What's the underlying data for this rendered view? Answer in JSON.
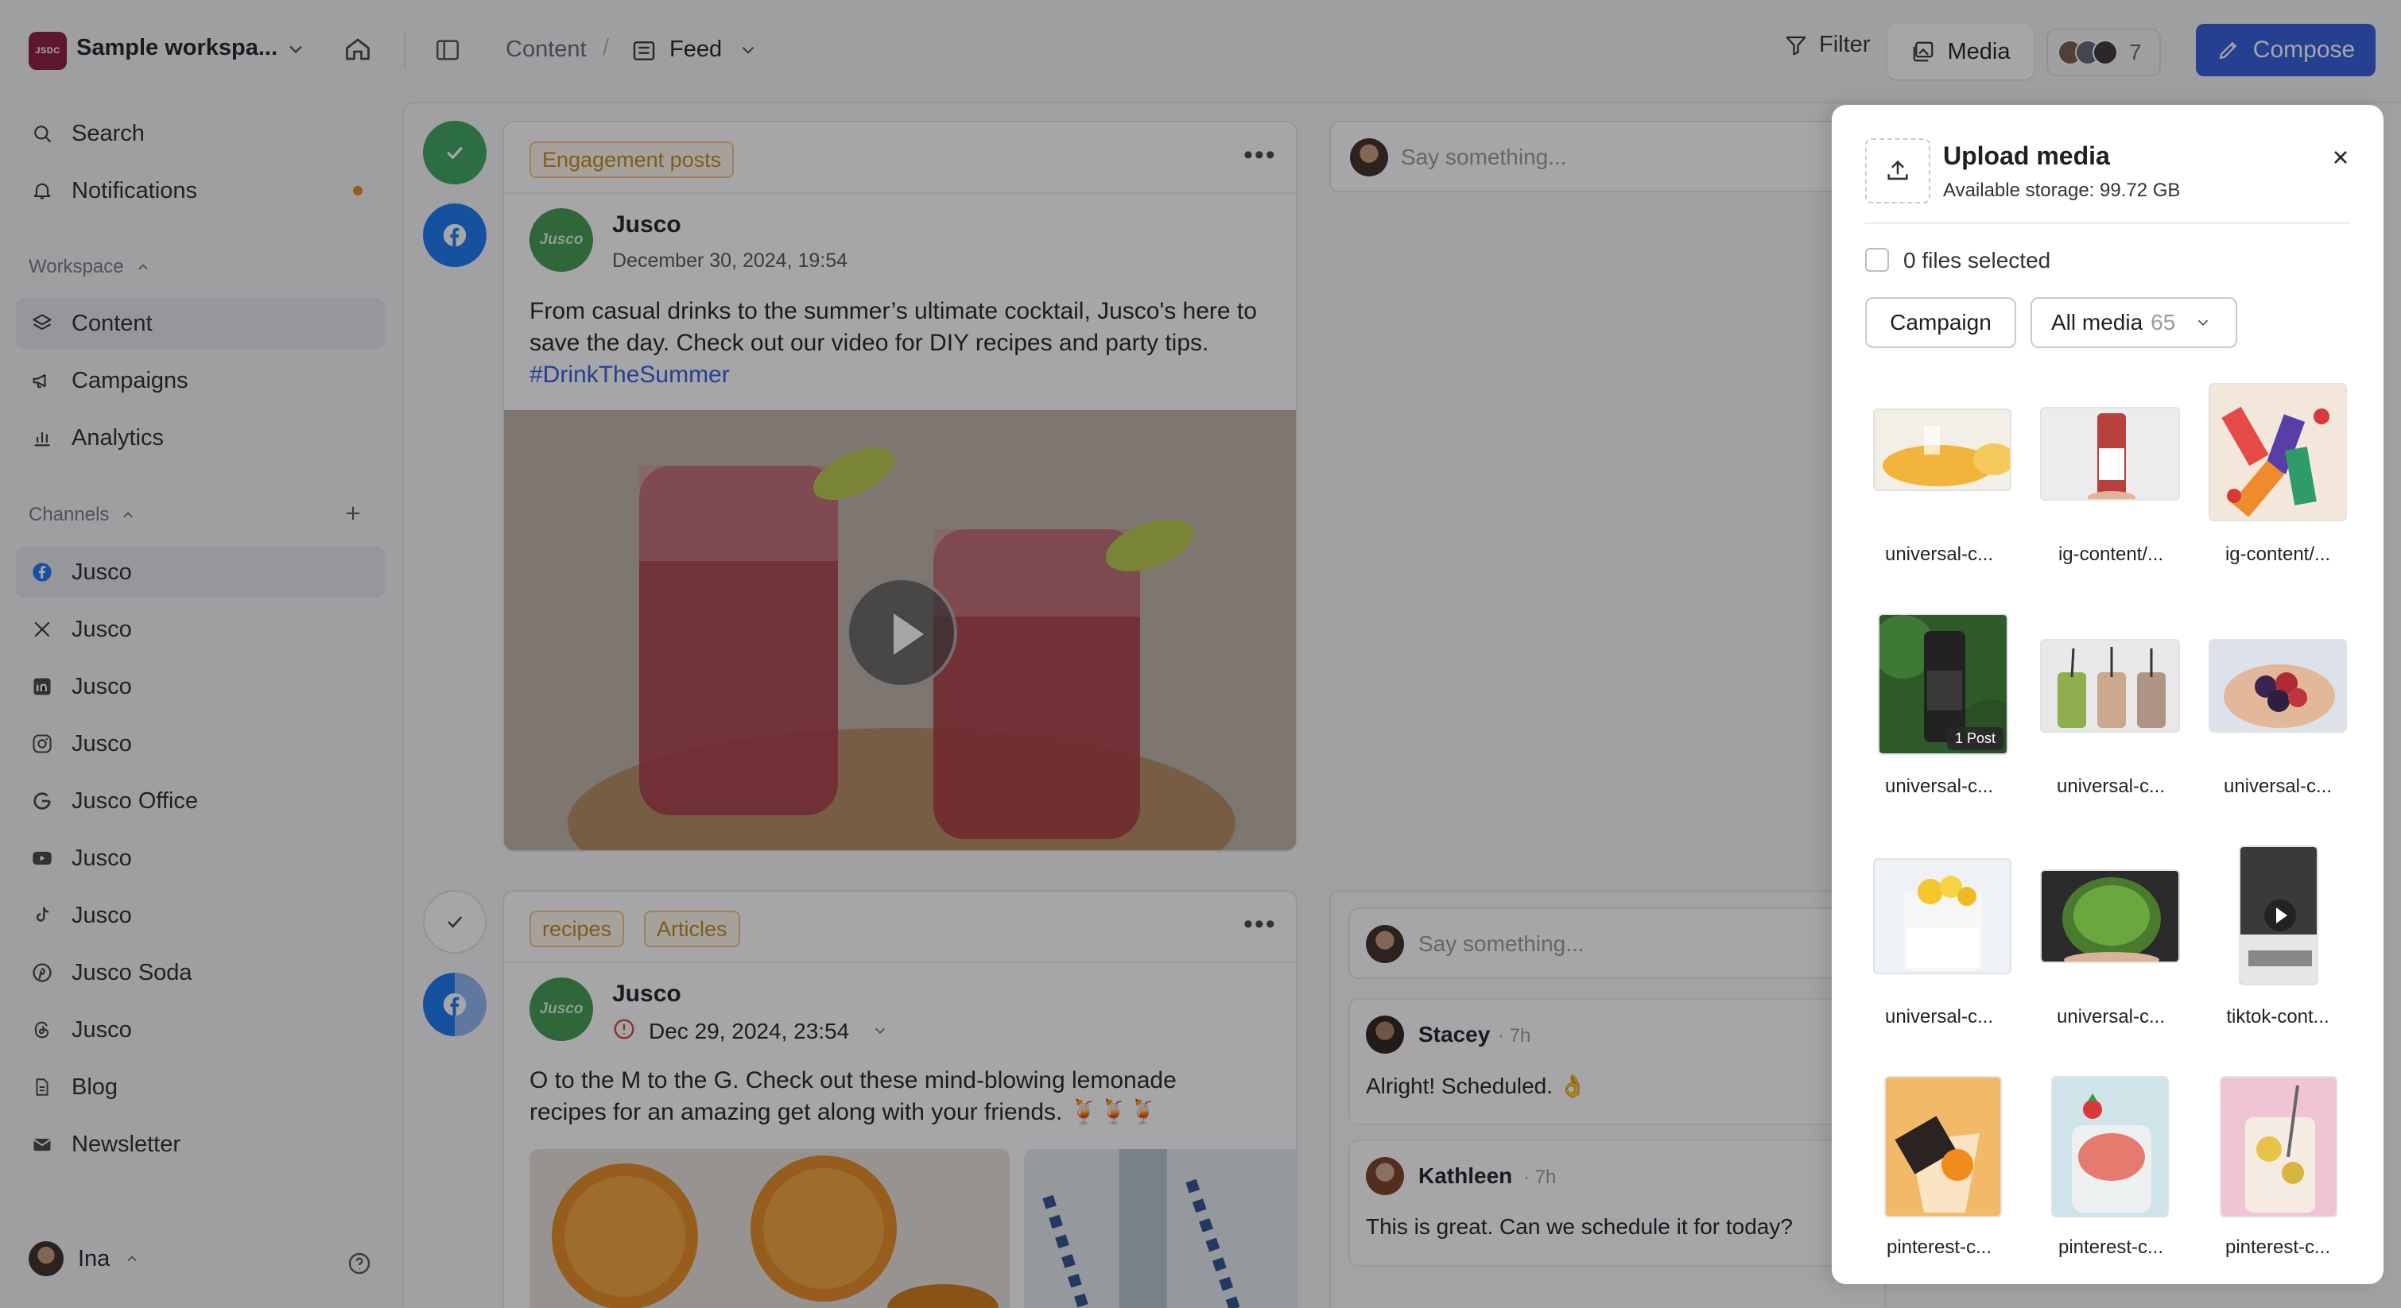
{
  "workspace": {
    "logo_text": "JSDC",
    "name": "Sample workspa..."
  },
  "breadcrumb": {
    "content": "Content",
    "separator": "/",
    "feed": "Feed"
  },
  "toolbar": {
    "filter_label": "Filter",
    "media_label": "Media",
    "collaborator_count": "7",
    "compose_label": "Compose"
  },
  "sidebar": {
    "search": "Search",
    "notifications": "Notifications",
    "workspace_label": "Workspace",
    "workspace_items": [
      "Content",
      "Campaigns",
      "Analytics"
    ],
    "channels_label": "Channels",
    "channels": [
      {
        "label": "Jusco",
        "icon": "facebook-icon"
      },
      {
        "label": "Jusco",
        "icon": "x-icon"
      },
      {
        "label": "Jusco",
        "icon": "linkedin-icon"
      },
      {
        "label": "Jusco",
        "icon": "instagram-icon"
      },
      {
        "label": "Jusco Office",
        "icon": "google-icon"
      },
      {
        "label": "Jusco",
        "icon": "youtube-icon"
      },
      {
        "label": "Jusco",
        "icon": "tiktok-icon"
      },
      {
        "label": "Jusco Soda",
        "icon": "pinterest-icon"
      },
      {
        "label": "Jusco",
        "icon": "threads-icon"
      },
      {
        "label": "Blog",
        "icon": "document-icon"
      },
      {
        "label": "Newsletter",
        "icon": "mail-icon"
      }
    ],
    "user": "Ina"
  },
  "posts": [
    {
      "tags": [
        "Engagement posts"
      ],
      "avatar_text": "Jusco",
      "author": "Jusco",
      "date": "December 30, 2024, 19:54",
      "text": "From casual drinks to the summer’s ultimate cocktail, Jusco's here to save the day. Check out our video for DIY recipes and party tips.",
      "hashtag": "#DrinkTheSummer",
      "comment_placeholder": "Say something..."
    },
    {
      "tags": [
        "recipes",
        "Articles"
      ],
      "avatar_text": "Jusco",
      "author": "Jusco",
      "date": "Dec 29, 2024, 23:54",
      "text": "O to the M to the G. Check out these mind-blowing lemonade recipes for an amazing get along with your friends. 🍹🍹🍹",
      "comment_placeholder": "Say something...",
      "comments": [
        {
          "author": "Stacey",
          "time": "· 7h",
          "text": "Alright! Scheduled. 👌"
        },
        {
          "author": "Kathleen",
          "time": "· 7h",
          "text": "This is great. Can we schedule it for today?"
        }
      ]
    }
  ],
  "media_panel": {
    "title": "Upload media",
    "storage": "Available storage: 99.72 GB",
    "selected": "0 files selected",
    "campaign_button": "Campaign",
    "filter_label": "All media",
    "filter_count": "65",
    "items": [
      {
        "label": "universal-c..."
      },
      {
        "label": "ig-content/..."
      },
      {
        "label": "ig-content/..."
      },
      {
        "label": "universal-c...",
        "badge": "1 Post"
      },
      {
        "label": "universal-c..."
      },
      {
        "label": "universal-c..."
      },
      {
        "label": "universal-c..."
      },
      {
        "label": "universal-c..."
      },
      {
        "label": "tiktok-cont..."
      },
      {
        "label": "pinterest-c..."
      },
      {
        "label": "pinterest-c..."
      },
      {
        "label": "pinterest-c..."
      }
    ]
  },
  "colors": {
    "accent": "#2f5bd8",
    "brand_green": "#3f9a4d",
    "status_green": "#3aa35a",
    "facebook": "#1877f2",
    "tag_orange": "#c0881f"
  }
}
